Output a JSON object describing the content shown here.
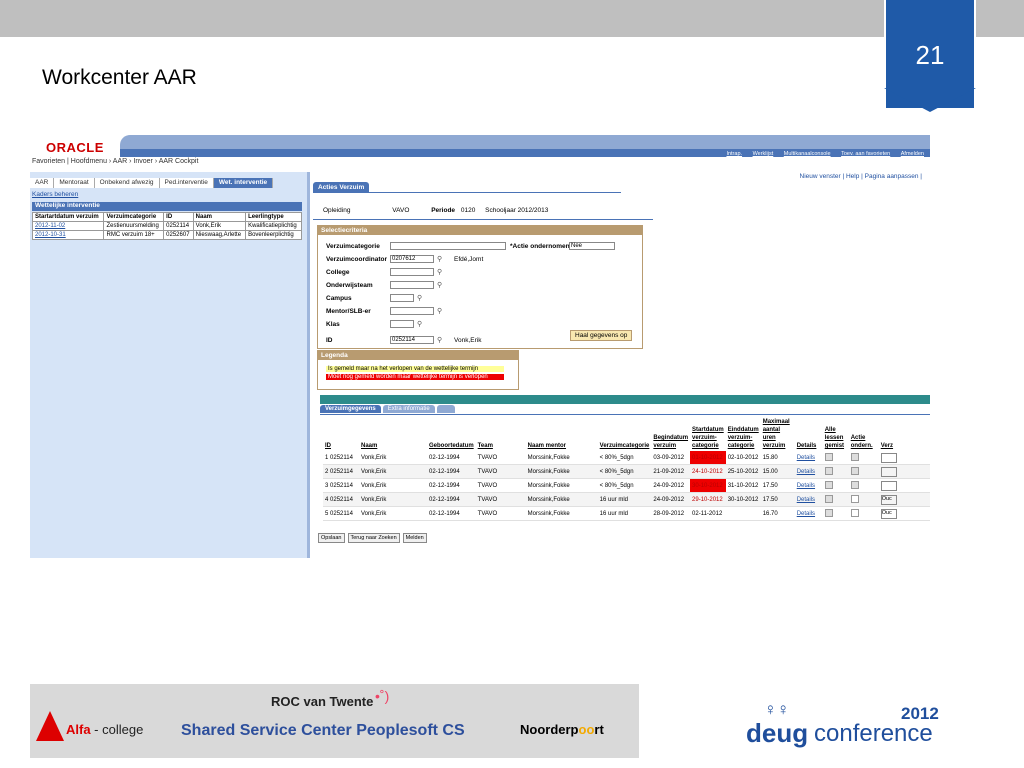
{
  "slide": {
    "number": "21",
    "title": "Workcenter AAR"
  },
  "app": {
    "logo": "ORACLE",
    "breadcrumb": "Favorieten  |  Hoofdmenu  ›  AAR  ›  Invoer  ›  AAR Cockpit",
    "top_links": [
      "Intrap.",
      "Werklijst",
      "Multikanaalconsole",
      "Toev. aan favorieten",
      "Afmelden"
    ],
    "right_links": "Nieuw venster | Help | Pagina aanpassen |"
  },
  "left": {
    "tabs": [
      "AAR",
      "Mentoraat",
      "Onbekend afwezig",
      "Ped.interventie",
      "Wet. interventie"
    ],
    "active_tab": "Wet. interventie",
    "kaders_link": "Kaders beheren",
    "panel_title": "Wettelijke interventie",
    "columns": [
      "Startartdatum verzuim",
      "Verzuimcategorie",
      "ID",
      "Naam",
      "Leerlingtype"
    ],
    "rows": [
      [
        "2012-11-02",
        "Zestienuursmelding",
        "0252114",
        "Vonk,Erik",
        "Kwalificatieplichtig"
      ],
      [
        "2012-10-31",
        "RMC verzuim 18+",
        "0252607",
        "Nieswaag,Arlette",
        "Bovenleerplichtig"
      ]
    ]
  },
  "main": {
    "tab": "Acties Verzuim",
    "opleiding_label": "Opleiding",
    "opleiding_value": "VAVO",
    "periode_label": "Periode",
    "periode_value": "0120",
    "schooljaar": "Schooljaar 2012/2013",
    "selectie_title": "Selectiecriteria",
    "fields": {
      "verzuimcategorie": "Verzuimcategorie",
      "actie_label": "*Actie ondernomen",
      "actie_value": "Nee",
      "verzuimcoordinator": "Verzuimcoordinator",
      "verzuimcoordinator_value": "0207612",
      "verzuimcoordinator_name": "Efdé,Jomt",
      "college": "College",
      "onderwijsteam": "Onderwijsteam",
      "campus": "Campus",
      "mentor": "Mentor/SLB-er",
      "klas": "Klas",
      "id": "ID",
      "id_value": "0252114",
      "id_name": "Vonk,Erik"
    },
    "haal_button": "Haal gegevens op",
    "legenda_title": "Legenda",
    "legenda": [
      "Is gemeld maar na het verlopen van de wettelijke termijn",
      "Moet nog gemeld worden maar wettelijke termijn is verlopen"
    ],
    "grid_tabs": [
      "Verzuimgegevens",
      "Extra informatie"
    ],
    "grid_columns": [
      "ID",
      "Naam",
      "Geboortedatum",
      "Team",
      "Naam mentor",
      "Verzuimcategorie",
      "Begindatum verzuim",
      "Startdatum verzuim-categorie",
      "Einddatum verzuim-categorie",
      "Maximaal aantal uren verzuim",
      "Details",
      "Alle lessen gemist",
      "Actie ondern.",
      "Verz"
    ],
    "grid_rows": [
      {
        "n": "1",
        "id": "0252114",
        "naam": "Vonk,Erik",
        "geb": "02-12-1994",
        "team": "TVAVO",
        "mentor": "Morssink,Fokke",
        "cat": "< 80%_5dgn",
        "begin": "03-09-2012",
        "start": "01-10-2012",
        "eind": "02-10-2012",
        "uren": "15.80",
        "details": "Details",
        "sel": ""
      },
      {
        "n": "2",
        "id": "0252114",
        "naam": "Vonk,Erik",
        "geb": "02-12-1994",
        "team": "TVAVO",
        "mentor": "Morssink,Fokke",
        "cat": "< 80%_5dgn",
        "begin": "21-09-2012",
        "start": "24-10-2012",
        "eind": "25-10-2012",
        "uren": "15.00",
        "details": "Details",
        "sel": ""
      },
      {
        "n": "3",
        "id": "0252114",
        "naam": "Vonk,Erik",
        "geb": "02-12-1994",
        "team": "TVAVO",
        "mentor": "Morssink,Fokke",
        "cat": "< 80%_5dgn",
        "begin": "24-09-2012",
        "start": "30-10-2012",
        "eind": "31-10-2012",
        "uren": "17.50",
        "details": "Details",
        "sel": ""
      },
      {
        "n": "4",
        "id": "0252114",
        "naam": "Vonk,Erik",
        "geb": "02-12-1994",
        "team": "TVAVO",
        "mentor": "Morssink,Fokke",
        "cat": "16 uur mld",
        "begin": "24-09-2012",
        "start": "29-10-2012",
        "eind": "30-10-2012",
        "uren": "17.50",
        "details": "Details",
        "sel": "Ouc"
      },
      {
        "n": "5",
        "id": "0252114",
        "naam": "Vonk,Erik",
        "geb": "02-12-1994",
        "team": "TVAVO",
        "mentor": "Morssink,Fokke",
        "cat": "16 uur mld",
        "begin": "28-09-2012",
        "start": "02-11-2012",
        "eind": "",
        "uren": "16.70",
        "details": "Details",
        "sel": "Ouc"
      }
    ],
    "bottom_buttons": [
      "Opslaan",
      "Terug naar Zoeken",
      "Melden"
    ]
  },
  "footer": {
    "alfa_brand": "Alfa",
    "alfa_suffix": " - college",
    "roc": "ROC van Twente",
    "ssc": "Shared Service Center Peoplesoft CS",
    "noord_a": "Noorderp",
    "noord_b": "oo",
    "noord_c": "rt",
    "deug": "deug",
    "conference": "conference",
    "year": "2012"
  },
  "colors": {
    "accent": "#1f5aa8",
    "highlight_red": "#e00000",
    "highlight_yellow": "#ffff99"
  }
}
